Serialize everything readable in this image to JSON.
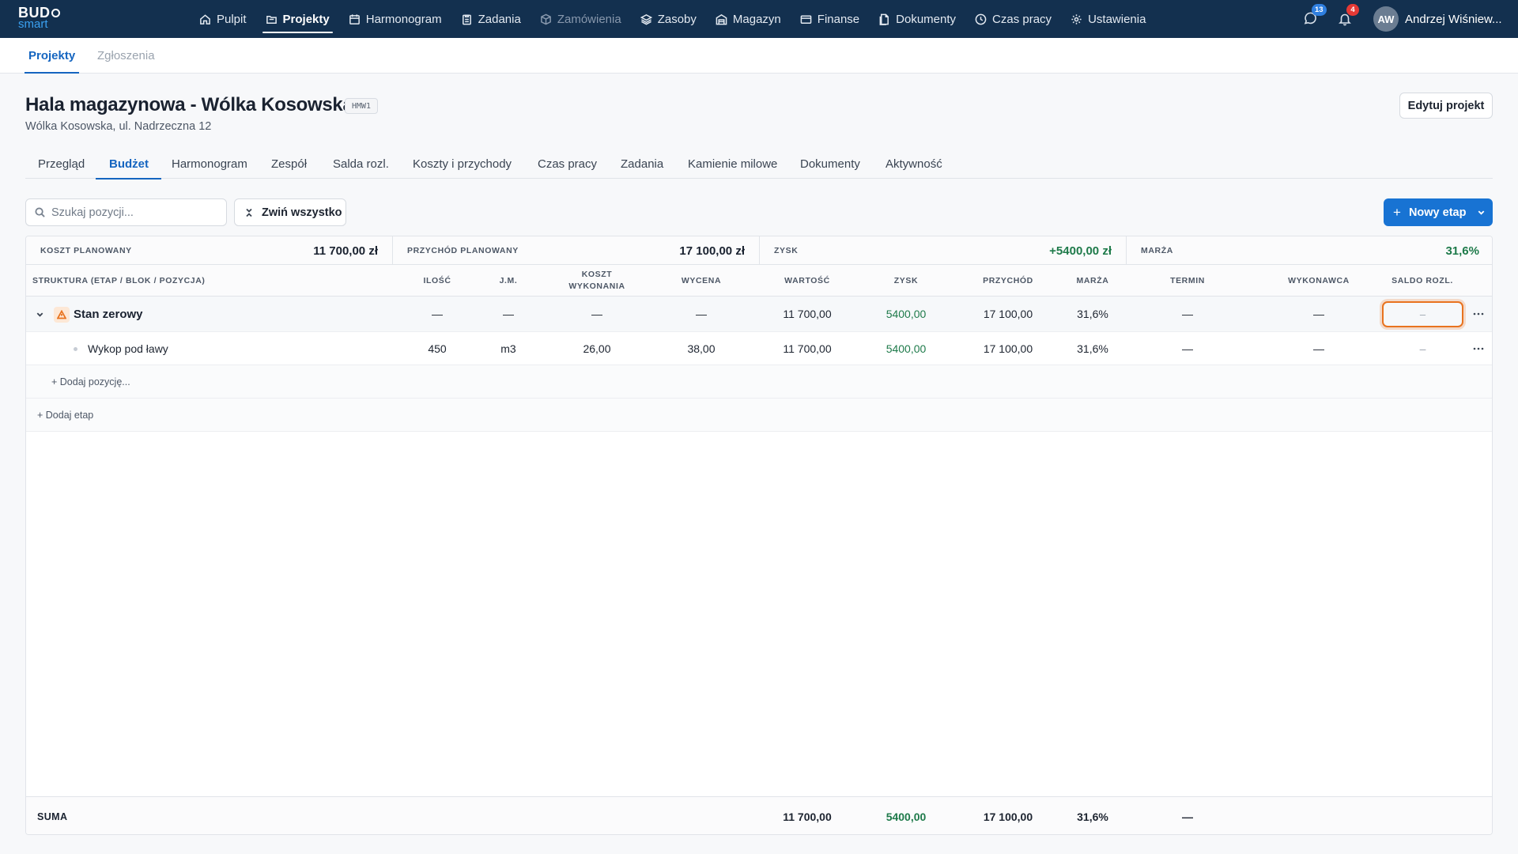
{
  "brand": {
    "line1": "BUD",
    "line2": "smart"
  },
  "nav": [
    {
      "label": "Pulpit",
      "icon": "home-icon"
    },
    {
      "label": "Projekty",
      "icon": "folder-icon",
      "active": true
    },
    {
      "label": "Harmonogram",
      "icon": "calendar-icon"
    },
    {
      "label": "Zadania",
      "icon": "clipboard-icon"
    },
    {
      "label": "Zamówienia",
      "icon": "box-icon",
      "disabled": true
    },
    {
      "label": "Zasoby",
      "icon": "layers-icon"
    },
    {
      "label": "Magazyn",
      "icon": "warehouse-icon"
    },
    {
      "label": "Finanse",
      "icon": "credit-card-icon"
    },
    {
      "label": "Dokumenty",
      "icon": "documents-icon"
    },
    {
      "label": "Czas pracy",
      "icon": "clock-icon"
    },
    {
      "label": "Ustawienia",
      "icon": "gear-icon"
    }
  ],
  "notifications": {
    "messages_count": "13",
    "alerts_count": "4"
  },
  "user": {
    "initials": "AW",
    "name": "Andrzej Wiśniew..."
  },
  "subtabs": [
    {
      "label": "Projekty",
      "active": true
    },
    {
      "label": "Zgłoszenia"
    }
  ],
  "project": {
    "title": "Hala magazynowa - Wólka Kosowska",
    "code": "HMW1",
    "address": "Wólka Kosowska, ul. Nadrzeczna 12",
    "edit_label": "Edytuj projekt"
  },
  "project_tabs": [
    {
      "label": "Przegląd"
    },
    {
      "label": "Budżet",
      "active": true
    },
    {
      "label": "Harmonogram"
    },
    {
      "label": "Zespół"
    },
    {
      "label": "Salda rozl."
    },
    {
      "label": "Koszty i przychody"
    },
    {
      "label": "Czas pracy"
    },
    {
      "label": "Zadania"
    },
    {
      "label": "Kamienie milowe"
    },
    {
      "label": "Dokumenty"
    },
    {
      "label": "Aktywność"
    }
  ],
  "toolbar": {
    "search_placeholder": "Szukaj pozycji...",
    "collapse_label": "Zwiń wszystko",
    "new_stage_label": "Nowy etap"
  },
  "summary": [
    {
      "label": "KOSZT PLANOWANY",
      "value": "11 700,00 zł"
    },
    {
      "label": "PRZYCHÓD PLANOWANY",
      "value": "17 100,00 zł"
    },
    {
      "label": "ZYSK",
      "value": "+5400,00 zł"
    },
    {
      "label": "MARŻA",
      "value": "31,6%"
    }
  ],
  "columns": {
    "structure": "STRUKTURA (ETAP / BLOK / POZYCJA)",
    "qty": "ILOŚĆ",
    "unit": "J.M.",
    "cost_line1": "KOSZT",
    "cost_line2": "WYKONANIA",
    "price": "WYCENA",
    "value": "WARTOŚĆ",
    "profit": "ZYSK",
    "revenue": "PRZYCHÓD",
    "margin": "MARŻA",
    "deadline": "TERMIN",
    "contractor": "WYKONAWCA",
    "balance": "SALDO ROZL."
  },
  "stage": {
    "name": "Stan zerowy",
    "qty": "—",
    "unit": "—",
    "cost": "—",
    "price": "—",
    "value": "11 700,00",
    "profit": "5400,00",
    "revenue": "17 100,00",
    "margin": "31,6%",
    "deadline": "—",
    "contractor": "—",
    "balance": "–"
  },
  "item": {
    "name": "Wykop pod ławy",
    "qty": "450",
    "unit": "m3",
    "cost": "26,00",
    "price": "38,00",
    "value": "11 700,00",
    "profit": "5400,00",
    "revenue": "17 100,00",
    "margin": "31,6%",
    "deadline": "—",
    "contractor": "—",
    "balance": "–"
  },
  "add_position_label": "+ Dodaj pozycję...",
  "add_stage_label": "+ Dodaj etap",
  "footer": {
    "label": "SUMA",
    "value": "11 700,00",
    "profit": "5400,00",
    "revenue": "17 100,00",
    "margin": "31,6%",
    "deadline": "—"
  },
  "colors": {
    "nav_bg": "#13304f",
    "accent": "#1873d3",
    "profit_green": "#1e7a4a",
    "focus_orange": "#e8731f"
  }
}
